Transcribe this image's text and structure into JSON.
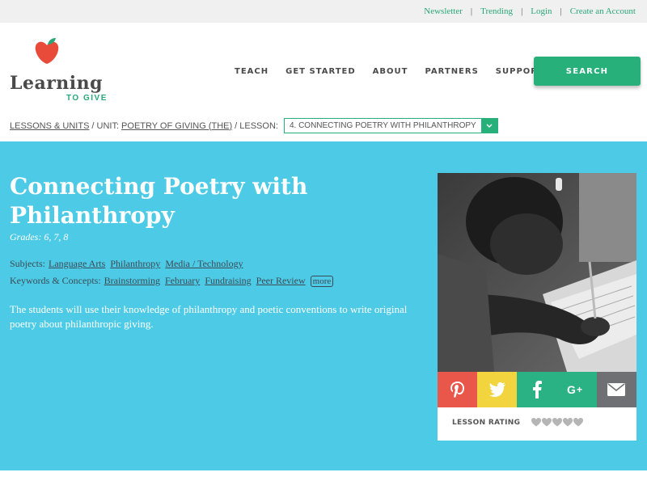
{
  "top_links": {
    "newsletter": "Newsletter",
    "trending": "Trending",
    "login": "Login",
    "create_account": "Create an Account",
    "separator": "|"
  },
  "logo": {
    "word": "Learning",
    "sub": "TO GIVE",
    "apple_color": "#e84b3a",
    "leaf_color": "#2aa779"
  },
  "nav": {
    "items": [
      "TEACH",
      "GET STARTED",
      "ABOUT",
      "PARTNERS",
      "SUPPORT US"
    ],
    "search_label": "SEARCH"
  },
  "breadcrumb": {
    "lessons_units": "LESSONS & UNITS",
    "unit_prefix": "/ UNIT:",
    "unit": "POETRY OF GIVING (THE)",
    "lesson_prefix": "/ LESSON:",
    "lesson_selected": "4. CONNECTING POETRY WITH PHILANTHROPY"
  },
  "lesson": {
    "title": "Connecting Poetry with Philanthropy",
    "grades": "Grades: 6, 7, 8",
    "subjects_label": "Subjects:",
    "subjects": [
      "Language Arts",
      "Philanthropy",
      "Media / Technology"
    ],
    "keywords_label": "Keywords & Concepts:",
    "keywords": [
      "Brainstorming",
      "February",
      "Fundraising",
      "Peer Review"
    ],
    "more_label": "more",
    "description": "The students will use their knowledge of philanthropy and poetic conventions to write original poetry about philanthropic giving."
  },
  "card": {
    "social": [
      {
        "name": "pinterest",
        "color": "#e9564a"
      },
      {
        "name": "twitter",
        "color": "#f2d43e"
      },
      {
        "name": "facebook",
        "color": "#2ab284"
      },
      {
        "name": "google-plus",
        "color": "#2ab284"
      },
      {
        "name": "email",
        "color": "#6e7073"
      }
    ],
    "rating_label": "LESSON RATING",
    "rating_value": 0,
    "rating_max": 5
  },
  "colors": {
    "hero_bg": "#4dcbe6",
    "accent_green": "#27b07a"
  }
}
